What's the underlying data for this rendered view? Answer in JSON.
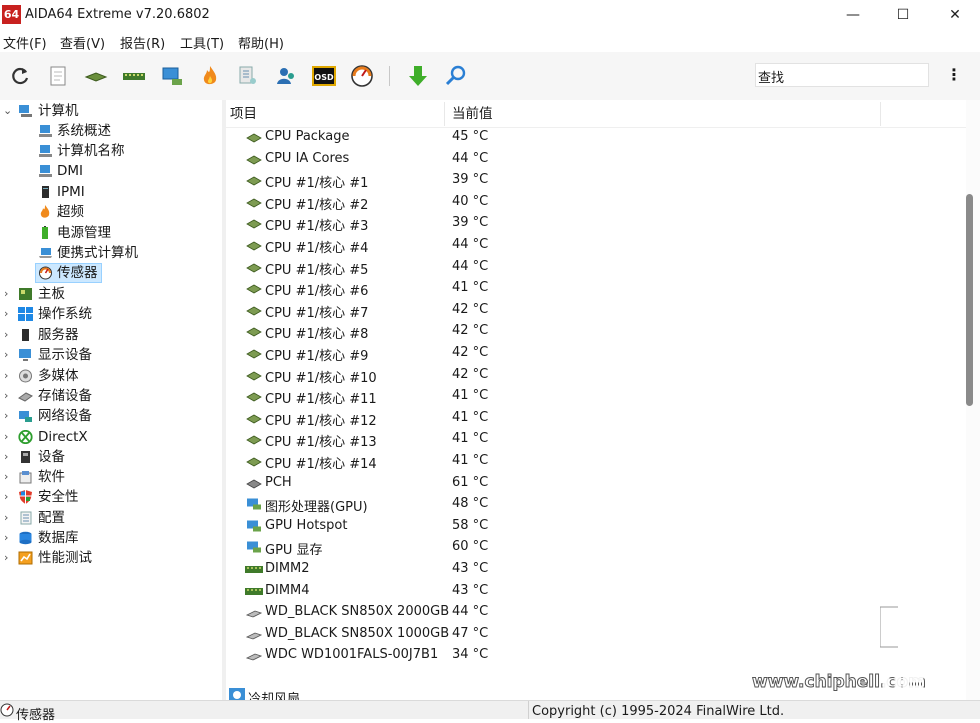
{
  "window": {
    "title": "AIDA64 Extreme v7.20.6802",
    "logo_text": "64",
    "minimize": "—",
    "maximize": "☐",
    "close": "✕"
  },
  "menu": [
    "文件(F)",
    "查看(V)",
    "报告(R)",
    "工具(T)",
    "帮助(H)"
  ],
  "toolbar": {
    "icons": [
      "refresh-icon",
      "report-icon",
      "motherboard-icon",
      "memory-icon",
      "computer-icon",
      "flame-icon",
      "network-icon",
      "user-icon",
      "osd-icon",
      "gauge-icon",
      "download-icon",
      "search-icon"
    ],
    "search_value": "查找",
    "more": "⋮"
  },
  "tree": {
    "root": "计算机",
    "children": [
      "系统概述",
      "计算机名称",
      "DMI",
      "IPMI",
      "超频",
      "电源管理",
      "便携式计算机",
      "传感器"
    ],
    "selected": "传感器",
    "top_items": [
      "主板",
      "操作系统",
      "服务器",
      "显示设备",
      "多媒体",
      "存储设备",
      "网络设备",
      "DirectX",
      "设备",
      "软件",
      "安全性",
      "配置",
      "数据库",
      "性能测试"
    ]
  },
  "list": {
    "col_item": "项目",
    "col_value": "当前值",
    "rows": [
      {
        "name": "CPU Package",
        "value": "45 °C",
        "icon": "cpu"
      },
      {
        "name": "CPU IA Cores",
        "value": "44 °C",
        "icon": "cpu"
      },
      {
        "name": "CPU #1/核心 #1",
        "value": "39 °C",
        "icon": "cpu"
      },
      {
        "name": "CPU #1/核心 #2",
        "value": "40 °C",
        "icon": "cpu"
      },
      {
        "name": "CPU #1/核心 #3",
        "value": "39 °C",
        "icon": "cpu"
      },
      {
        "name": "CPU #1/核心 #4",
        "value": "44 °C",
        "icon": "cpu"
      },
      {
        "name": "CPU #1/核心 #5",
        "value": "44 °C",
        "icon": "cpu"
      },
      {
        "name": "CPU #1/核心 #6",
        "value": "41 °C",
        "icon": "cpu"
      },
      {
        "name": "CPU #1/核心 #7",
        "value": "42 °C",
        "icon": "cpu"
      },
      {
        "name": "CPU #1/核心 #8",
        "value": "42 °C",
        "icon": "cpu"
      },
      {
        "name": "CPU #1/核心 #9",
        "value": "42 °C",
        "icon": "cpu"
      },
      {
        "name": "CPU #1/核心 #10",
        "value": "42 °C",
        "icon": "cpu"
      },
      {
        "name": "CPU #1/核心 #11",
        "value": "41 °C",
        "icon": "cpu"
      },
      {
        "name": "CPU #1/核心 #12",
        "value": "41 °C",
        "icon": "cpu"
      },
      {
        "name": "CPU #1/核心 #13",
        "value": "41 °C",
        "icon": "cpu"
      },
      {
        "name": "CPU #1/核心 #14",
        "value": "41 °C",
        "icon": "cpu"
      },
      {
        "name": "PCH",
        "value": "61 °C",
        "icon": "chip"
      },
      {
        "name": "图形处理器(GPU)",
        "value": "48 °C",
        "icon": "gpu"
      },
      {
        "name": "GPU Hotspot",
        "value": "58 °C",
        "icon": "gpu"
      },
      {
        "name": "GPU 显存",
        "value": "60 °C",
        "icon": "gpu"
      },
      {
        "name": "DIMM2",
        "value": "43 °C",
        "icon": "dimm"
      },
      {
        "name": "DIMM4",
        "value": "43 °C",
        "icon": "dimm"
      },
      {
        "name": "WD_BLACK SN850X 2000GB",
        "value": "44 °C",
        "icon": "disk"
      },
      {
        "name": "WD_BLACK SN850X 1000GB",
        "value": "47 °C",
        "icon": "disk"
      },
      {
        "name": "WDC WD1001FALS-00J7B1",
        "value": "34 °C",
        "icon": "disk"
      }
    ],
    "next_section": "冷却风扇"
  },
  "status": {
    "left": "传感器",
    "right": "Copyright (c) 1995-2024 FinalWire Ltd."
  },
  "watermark": {
    "url": "www.chiphell.com",
    "logo": "chip hell"
  }
}
